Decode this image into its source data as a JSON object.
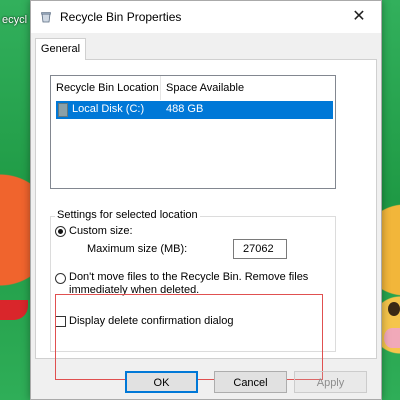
{
  "desktop": {
    "label": "ecycl"
  },
  "window": {
    "title": "Recycle Bin Properties",
    "close_glyph": "✕",
    "icon": "recycle-bin-icon"
  },
  "tabs": [
    {
      "label": "General",
      "active": true
    }
  ],
  "location_list": {
    "columns": [
      "Recycle Bin Location",
      "Space Available"
    ],
    "rows": [
      {
        "location": "Local Disk (C:)",
        "space": "488 GB",
        "selected": true
      }
    ]
  },
  "settings": {
    "group_title": "Settings for selected location",
    "custom_size_label": "Custom size:",
    "custom_size_selected": true,
    "max_size_label": "Maximum size (MB):",
    "max_size_value": "27062",
    "dont_move_line1": "Don't move files to the Recycle Bin. Remove files",
    "dont_move_line2": "immediately when deleted.",
    "dont_move_selected": false,
    "confirm_label": "Display delete confirmation dialog",
    "confirm_checked": false
  },
  "buttons": {
    "ok": "OK",
    "cancel": "Cancel",
    "apply": "Apply"
  },
  "colors": {
    "selection": "#0078d7",
    "highlight_box": "#e05050"
  }
}
